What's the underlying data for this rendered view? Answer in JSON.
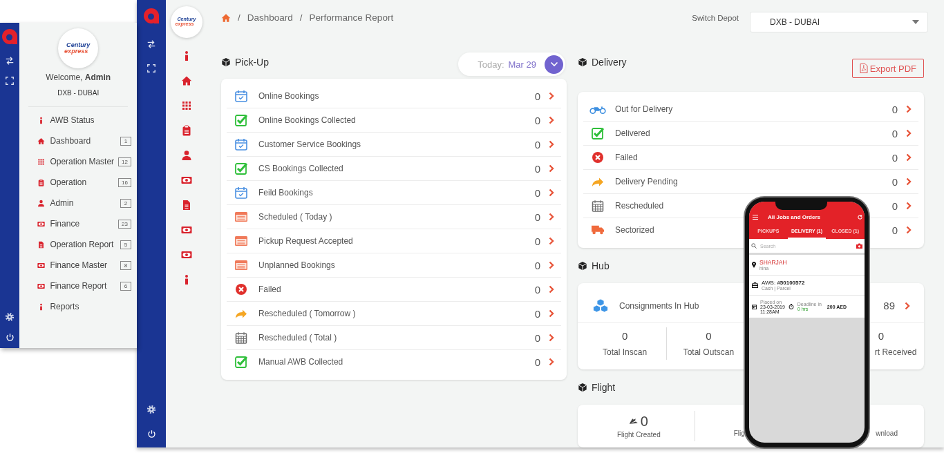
{
  "left_panel": {
    "logo": {
      "line1": "Century",
      "line2": "express"
    },
    "welcome": "Welcome, **Admin**",
    "depot": "DXB - DUBAI",
    "menu": [
      {
        "kind": "info",
        "label": "AWB Status"
      },
      {
        "kind": "home",
        "label": "Dashboard",
        "badge": "1"
      },
      {
        "kind": "grid",
        "label": "Operation Master",
        "badge": "12"
      },
      {
        "kind": "clipboard",
        "label": "Operation",
        "badge": "16"
      },
      {
        "kind": "user",
        "label": "Admin",
        "badge": "2"
      },
      {
        "kind": "money",
        "label": "Finance",
        "badge": "23"
      },
      {
        "kind": "report",
        "label": "Operation Report",
        "badge": "5"
      },
      {
        "kind": "money",
        "label": "Finance Master",
        "badge": "8"
      },
      {
        "kind": "money",
        "label": "Finance Report",
        "badge": "6"
      },
      {
        "kind": "info",
        "label": "Reports"
      }
    ]
  },
  "app": {
    "logo": {
      "line1": "Century",
      "line2": "express"
    },
    "breadcrumb": [
      {
        "separator": "/",
        "label": "Dashboard"
      },
      {
        "separator": "/",
        "label": "Performance Report"
      }
    ],
    "depot_label": "Switch Depot",
    "depot_select": "DXB - DUBAI",
    "pickup": {
      "title": "Pick-Up",
      "date_label": "Today:",
      "date": "Mar 29",
      "rows": [
        {
          "kind": "booking",
          "label": "Online Bookings",
          "value": "0"
        },
        {
          "kind": "collected",
          "label": "Online Bookings Collected",
          "value": "0"
        },
        {
          "kind": "booking",
          "label": "Customer Service Bookings",
          "value": "0"
        },
        {
          "kind": "collected",
          "label": "CS Bookings Collected",
          "value": "0"
        },
        {
          "kind": "booking",
          "label": "Feild Bookings",
          "value": "0"
        },
        {
          "kind": "scheduled",
          "label": "Scheduled ( Today )",
          "value": "0"
        },
        {
          "kind": "scheduled",
          "label": "Pickup Request Accepted",
          "value": "0"
        },
        {
          "kind": "scheduled",
          "label": "Unplanned Bookings",
          "value": "0"
        },
        {
          "kind": "failed",
          "label": "Failed",
          "value": "0"
        },
        {
          "kind": "deferred",
          "label": "Rescheduled ( Tomorrow )",
          "value": "0"
        },
        {
          "kind": "calendar",
          "label": "Rescheduled ( Total )",
          "value": "0"
        },
        {
          "kind": "collected",
          "label": "Manual AWB Collected",
          "value": "0"
        }
      ]
    },
    "delivery": {
      "title": "Delivery",
      "export": "Export PDF",
      "rows": [
        {
          "kind": "transit",
          "label": "Out for Delivery",
          "value": "0"
        },
        {
          "kind": "collected",
          "label": "Delivered",
          "value": "0"
        },
        {
          "kind": "failed",
          "label": "Failed",
          "value": "0"
        },
        {
          "kind": "deferred",
          "label": "Delivery Pending",
          "value": "0"
        },
        {
          "kind": "calendar",
          "label": "Rescheduled",
          "value": "0"
        },
        {
          "kind": "sector",
          "label": "Sectorized",
          "value": "0"
        }
      ]
    },
    "hub": {
      "title": "Hub",
      "summary": {
        "label": "Consignments In Hub",
        "value": "89"
      },
      "stats": [
        {
          "value": "0",
          "label": "Total Inscan"
        },
        {
          "value": "0",
          "label": "Total Outscan"
        },
        {
          "value": "0",
          "label": "rt Received"
        }
      ]
    },
    "flight": {
      "title": "Flight",
      "stats": [
        {
          "value": "0",
          "label": "Flight Created"
        },
        {
          "label": "Flig"
        },
        {
          "label": "wnload"
        }
      ]
    }
  },
  "phone": {
    "title": "All Jobs and Orders",
    "tabs": [
      {
        "label": "PICKUPS",
        "selected": false
      },
      {
        "label": "DELIVERY (1)",
        "selected": true
      },
      {
        "label": "CLOSED (1)",
        "selected": false
      }
    ],
    "search": {
      "placeholder": "Search"
    },
    "order": {
      "city": "SHARJAH",
      "name": "hina",
      "awb": "AWB: **#50100572**",
      "details": "Cash | Parcel",
      "placed_label": "Placed on",
      "placed_date": "23-03-2019",
      "placed_time": "11:28AM",
      "deadline_label": "Deadline in",
      "deadline": "0 hrs",
      "amount": "200 AED"
    }
  }
}
